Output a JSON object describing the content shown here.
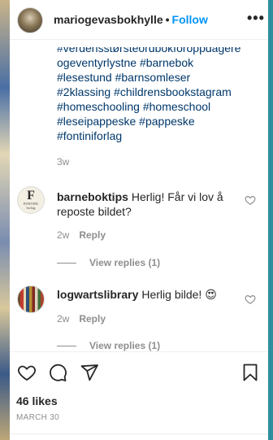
{
  "header": {
    "username": "mariogevasbokhylle",
    "separator": "•",
    "follow_label": "Follow",
    "more_icon": "more-options-icon",
    "more_glyph": "•••"
  },
  "caption": {
    "clipped_line": "#verdensstørsteordbokforoppdagere",
    "lines": [
      "ogeventyrlystne #barnebok",
      "#lesestund #barnsomleser",
      "#2klassing #childrensbookstagram",
      "#homeschooling #homeschool",
      "#leseipappeske #pappeske",
      "#fontiniforlag"
    ],
    "time": "3w"
  },
  "comments": [
    {
      "username": "barneboktips",
      "text": "Herlig! Får vi lov å reposte bildet?",
      "time": "2w",
      "reply_label": "Reply",
      "view_replies": "View replies (1)",
      "avatar_glyph": "F",
      "avatar_text": "FONTINI",
      "avatar_sub": "forlag"
    },
    {
      "username": "logwartslibrary",
      "text": "Herlig bilde! 😍",
      "time": "2w",
      "reply_label": "Reply",
      "view_replies": "View replies (1)"
    }
  ],
  "footer": {
    "likes": "46 likes",
    "date": "MARCH 30"
  },
  "colors": {
    "link": "#00376b",
    "follow": "#0095f6",
    "muted": "#8e8e8e",
    "border": "#2f8f9e"
  }
}
